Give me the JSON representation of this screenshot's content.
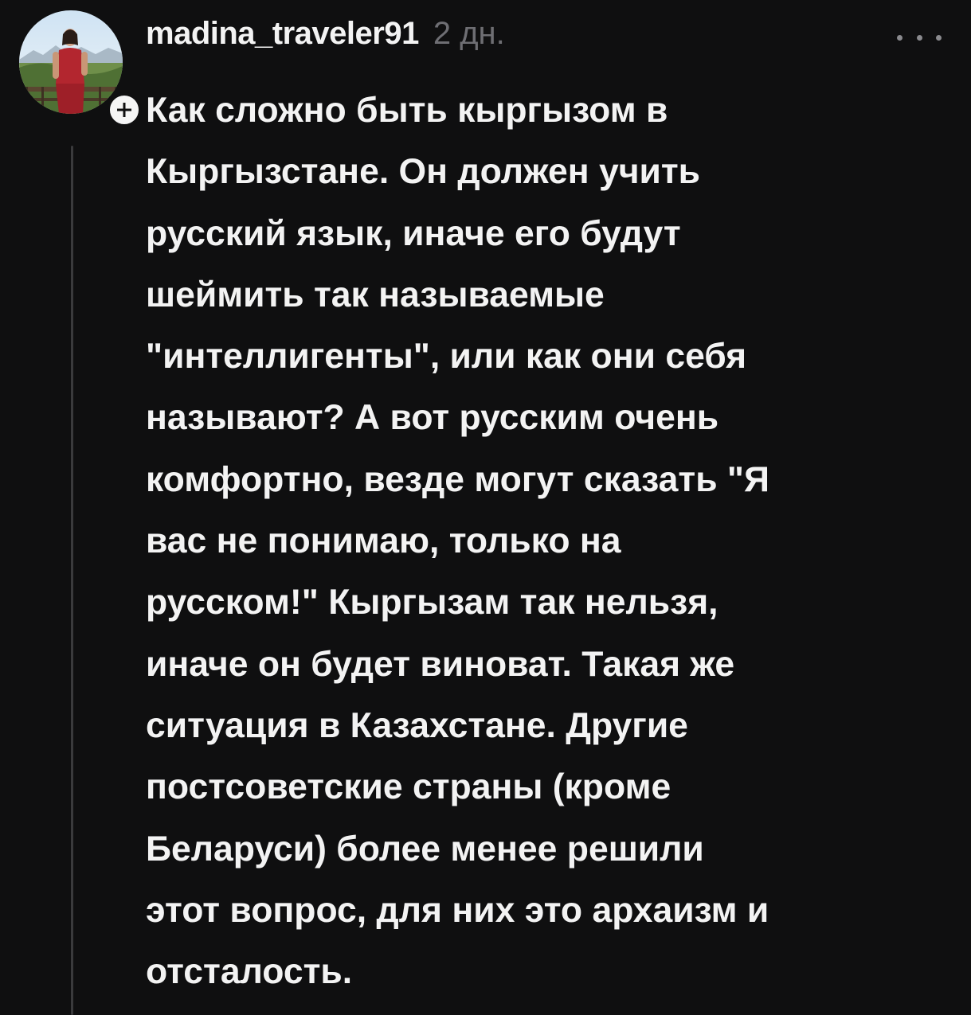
{
  "comment": {
    "username": "madina_traveler91",
    "time": "2 дн.",
    "avatar_icon": "profile-photo",
    "follow_icon": "plus-icon",
    "more_icon": "ellipsis-icon",
    "lines": [
      "Как сложно быть кыргызом в",
      "Кыргызстане. Он должен учить",
      "русский язык, иначе его будут",
      "шеймить так называемые",
      "\"интеллигенты\", или как они себя",
      "называют? А вот русским очень",
      "комфортно, везде могут сказать \"Я",
      "вас не понимаю, только на",
      "русском!\" Кыргызам так нельзя,",
      "иначе он будет виноват. Такая же",
      "ситуация в Казахстане. Другие",
      "постсоветские страны (кроме",
      "Беларуси) более менее решили",
      "этот вопрос, для них это архаизм и",
      "отсталость."
    ]
  }
}
